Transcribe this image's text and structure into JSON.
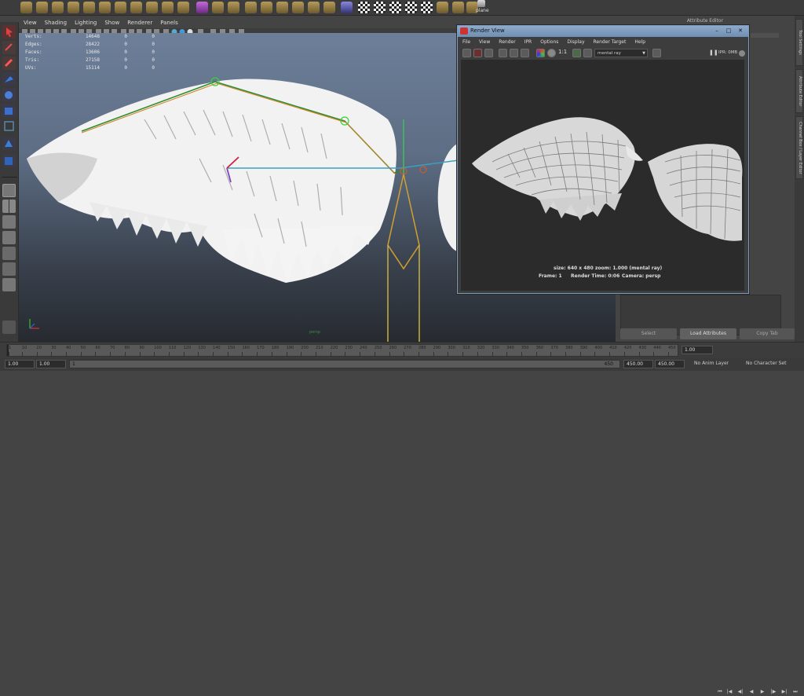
{
  "shelf": {
    "plane_label": "plane"
  },
  "viewport": {
    "menu": [
      "View",
      "Shading",
      "Lighting",
      "Show",
      "Renderer",
      "Panels"
    ],
    "hud": {
      "rows": [
        {
          "label": "Verts:",
          "value": "14648",
          "a": "0",
          "b": "0"
        },
        {
          "label": "Edges:",
          "value": "28422",
          "a": "0",
          "b": "0"
        },
        {
          "label": "Faces:",
          "value": "13606",
          "a": "0",
          "b": "0"
        },
        {
          "label": "Tris:",
          "value": "27158",
          "a": "0",
          "b": "0"
        },
        {
          "label": "UVs:",
          "value": "15114",
          "a": "0",
          "b": "0"
        }
      ]
    },
    "camera_label": "persp"
  },
  "attribute_editor": {
    "title": "Attribute Editor",
    "buttons": {
      "select": "Select",
      "load": "Load Attributes",
      "copy": "Copy Tab"
    }
  },
  "side_tabs": [
    "Tool Settings",
    "Attribute Editor",
    "Channel Box / Layer Editor"
  ],
  "render_view": {
    "title": "Render View",
    "controls": [
      "–",
      "□",
      "✕"
    ],
    "menu": [
      "File",
      "View",
      "Render",
      "IPR",
      "Options",
      "Display",
      "Render Target",
      "Help"
    ],
    "one_to_one": "1:1",
    "renderer": "mental ray",
    "ipr_status": "IPR: 0MB",
    "info_line1": "size: 640 x 480  zoom: 1.000     (mental ray)",
    "info_frame": "Frame: 1",
    "info_time": "Render Time: 0:06",
    "info_camera": "Camera: persp"
  },
  "time_slider": {
    "ticks": [
      "1",
      "10",
      "20",
      "30",
      "40",
      "50",
      "60",
      "70",
      "80",
      "90",
      "100",
      "110",
      "120",
      "130",
      "140",
      "150",
      "160",
      "170",
      "180",
      "190",
      "200",
      "210",
      "220",
      "230",
      "240",
      "250",
      "260",
      "270",
      "280",
      "290",
      "300",
      "310",
      "320",
      "330",
      "340",
      "350",
      "360",
      "370",
      "380",
      "390",
      "400",
      "410",
      "420",
      "430",
      "440",
      "450"
    ],
    "current_frame": "1.00"
  },
  "range_slider": {
    "start": "1.00",
    "playback_start": "1.00",
    "range_start_label": "1",
    "range_end_label": "450",
    "playback_end": "450.00",
    "end": "450.00",
    "anim_layer": "No Anim Layer",
    "character_set": "No Character Set"
  },
  "colors": {
    "viewport_top": "#6d7f99",
    "viewport_bottom": "#272b30",
    "render_title": "#7d9bc0"
  }
}
